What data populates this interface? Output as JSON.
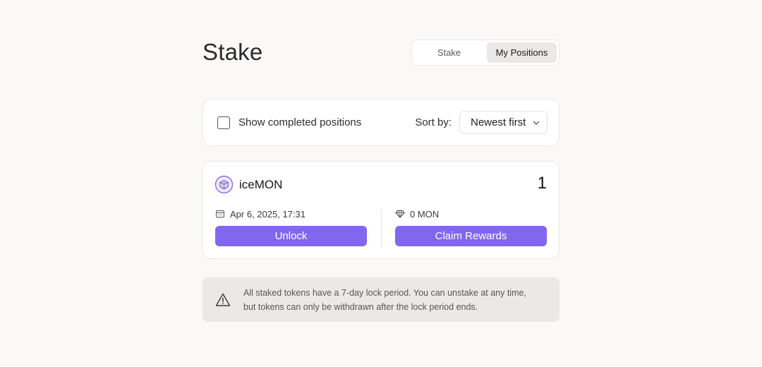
{
  "page": {
    "title": "Stake"
  },
  "tabs": [
    {
      "label": "Stake",
      "active": false
    },
    {
      "label": "My Positions",
      "active": true
    }
  ],
  "filters": {
    "show_completed_label": "Show completed positions",
    "show_completed_checked": false,
    "sort_label": "Sort by:",
    "sort_value": "Newest first"
  },
  "position": {
    "token_name": "iceMON",
    "token_icon": "dice-icon",
    "count": "1",
    "date": "Apr 6, 2025, 17:31",
    "date_icon": "calendar-icon",
    "rewards": "0 MON",
    "rewards_icon": "diamond-icon",
    "unlock_label": "Unlock",
    "claim_label": "Claim Rewards"
  },
  "notice": {
    "icon": "warning-icon",
    "line1": "All staked tokens have a 7-day lock period. You can unstake at any time,",
    "line2": "but tokens can only be withdrawn after the lock period ends."
  },
  "colors": {
    "accent": "#8167ee",
    "background": "#faf9f8",
    "notice_bg": "#ebe9e5"
  }
}
